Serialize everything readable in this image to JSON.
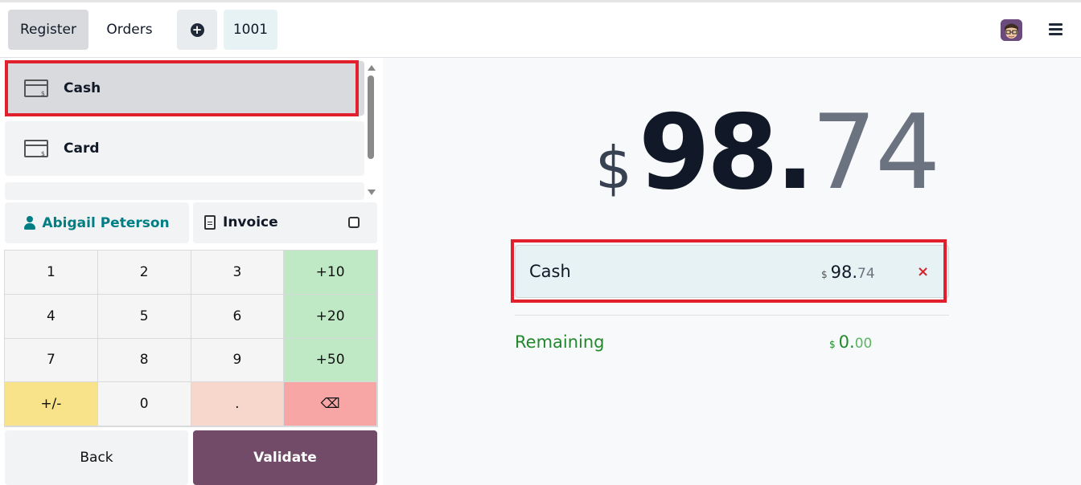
{
  "header": {
    "register_label": "Register",
    "orders_label": "Orders",
    "plus_icon": "plus-circle-icon",
    "order_number": "1001",
    "avatar": "user-avatar",
    "menu_icon": "hamburger-icon"
  },
  "payment_methods": [
    {
      "label": "Cash",
      "icon": "cash-register-icon",
      "selected": true
    },
    {
      "label": "Card",
      "icon": "cash-register-icon",
      "selected": false
    }
  ],
  "customer": {
    "name": "Abigail Peterson",
    "icon": "person-icon"
  },
  "invoice": {
    "label": "Invoice",
    "checked": false
  },
  "numpad": {
    "keys": [
      "1",
      "2",
      "3",
      "+10",
      "4",
      "5",
      "6",
      "+20",
      "7",
      "8",
      "9",
      "+50",
      "+/-",
      "0",
      ".",
      "⌫"
    ]
  },
  "actions": {
    "back_label": "Back",
    "validate_label": "Validate"
  },
  "total": {
    "currency": "$",
    "integer": "98.",
    "decimals": "74"
  },
  "payment_lines": [
    {
      "name": "Cash",
      "currency": "$",
      "integer": "98.",
      "decimals": "74",
      "delete": "×"
    }
  ],
  "remaining": {
    "label": "Remaining",
    "currency": "$",
    "integer": "0.",
    "decimals": "00"
  },
  "colors": {
    "accent": "#714b67",
    "teal": "#017e84",
    "success": "#21892b",
    "highlight": "#e0202c"
  }
}
